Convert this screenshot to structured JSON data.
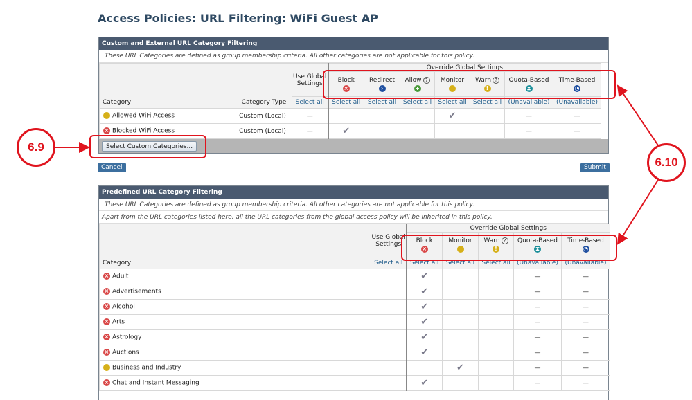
{
  "title": "Access Policies: URL Filtering: WiFi Guest AP",
  "colors": {
    "block": "#d94848",
    "redirect": "#1f4fa0",
    "allow": "#4a9a3a",
    "monitor": "#d6b019",
    "warn": "#d6b019",
    "quota": "#1b8f9a",
    "time": "#1f4fa0",
    "annotation": "#e0141e"
  },
  "custom": {
    "header": "Custom and External URL Category Filtering",
    "description": "These URL Categories are defined as group membership criteria. All other categories are not applicable for this policy.",
    "col_category": "Category",
    "col_type": "Category Type",
    "col_global": "Use Global Settings",
    "override": "Override Global Settings",
    "actions": [
      {
        "label": "Block",
        "icon": "block",
        "help": false,
        "select": "Select all"
      },
      {
        "label": "Redirect",
        "icon": "redirect",
        "help": false,
        "select": "Select all"
      },
      {
        "label": "Allow",
        "icon": "allow",
        "help": true,
        "select": "Select all"
      },
      {
        "label": "Monitor",
        "icon": "monitor",
        "help": false,
        "select": "Select all"
      },
      {
        "label": "Warn",
        "icon": "warn",
        "help": true,
        "select": "Select all"
      },
      {
        "label": "Quota-Based",
        "icon": "quota",
        "help": false,
        "select": "(Unavailable)"
      },
      {
        "label": "Time-Based",
        "icon": "time",
        "help": false,
        "select": "(Unavailable)"
      }
    ],
    "global_select": "Select all",
    "rows": [
      {
        "name": "Allowed WiFi Access",
        "icon": "monitor",
        "type": "Custom (Local)",
        "global": "—",
        "action": 3
      },
      {
        "name": "Blocked WiFi Access",
        "icon": "block",
        "type": "Custom (Local)",
        "global": "—",
        "action": 0
      }
    ],
    "select_button": "Select Custom Categories..."
  },
  "cancel": "Cancel",
  "submit": "Submit",
  "predefined": {
    "header": "Predefined URL Category Filtering",
    "description": "These URL Categories are defined as group membership criteria. All other categories are not applicable for this policy.",
    "description2": "Apart from the URL categories listed here, all the URL categories from the global access policy will be inherited in this policy.",
    "col_category": "Category",
    "col_global": "Use Global Settings",
    "override": "Override Global Settings",
    "global_select": "Select all",
    "actions": [
      {
        "label": "Block",
        "icon": "block",
        "help": false,
        "select": "Select all"
      },
      {
        "label": "Monitor",
        "icon": "monitor",
        "help": false,
        "select": "Select all"
      },
      {
        "label": "Warn",
        "icon": "warn",
        "help": true,
        "select": "Select all"
      },
      {
        "label": "Quota-Based",
        "icon": "quota",
        "help": false,
        "select": "(Unavailable)"
      },
      {
        "label": "Time-Based",
        "icon": "time",
        "help": false,
        "select": "(Unavailable)"
      }
    ],
    "rows": [
      {
        "name": "Adult",
        "icon": "block",
        "action": 0
      },
      {
        "name": "Advertisements",
        "icon": "block",
        "action": 0
      },
      {
        "name": "Alcohol",
        "icon": "block",
        "action": 0
      },
      {
        "name": "Arts",
        "icon": "block",
        "action": 0
      },
      {
        "name": "Astrology",
        "icon": "block",
        "action": 0
      },
      {
        "name": "Auctions",
        "icon": "block",
        "action": 0
      },
      {
        "name": "Business and Industry",
        "icon": "monitor",
        "action": 1
      },
      {
        "name": "Chat and Instant Messaging",
        "icon": "block",
        "action": 0
      }
    ]
  },
  "annotations": {
    "a1": "6.9",
    "a2": "6.10"
  }
}
